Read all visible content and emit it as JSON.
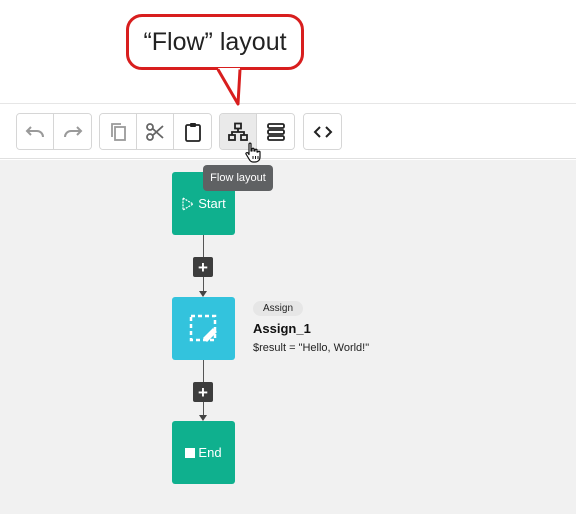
{
  "callout": {
    "text": "“Flow” layout"
  },
  "toolbar": {
    "buttons": [
      {
        "name": "undo",
        "icon": "undo-icon"
      },
      {
        "name": "redo",
        "icon": "redo-icon"
      },
      {
        "name": "copy",
        "icon": "copy-icon"
      },
      {
        "name": "cut",
        "icon": "scissors-icon"
      },
      {
        "name": "paste",
        "icon": "clipboard-icon"
      },
      {
        "name": "flow-layout",
        "icon": "flow-layout-icon",
        "active": true
      },
      {
        "name": "list-layout",
        "icon": "list-layout-icon"
      },
      {
        "name": "code-view",
        "icon": "code-icon"
      }
    ],
    "tooltip": "Flow layout"
  },
  "flow": {
    "start": {
      "label": "Start"
    },
    "assign": {
      "type_badge": "Assign",
      "title": "Assign_1",
      "description": "$result = \"Hello, World!\""
    },
    "end": {
      "label": "End"
    },
    "add_symbol": "+"
  },
  "colors": {
    "callout_border": "#d81e1e",
    "start_end_node": "#0fb08e",
    "assign_node": "#33c3dd",
    "tooltip_bg": "#5f6163",
    "canvas_bg": "#f1f1f1"
  }
}
